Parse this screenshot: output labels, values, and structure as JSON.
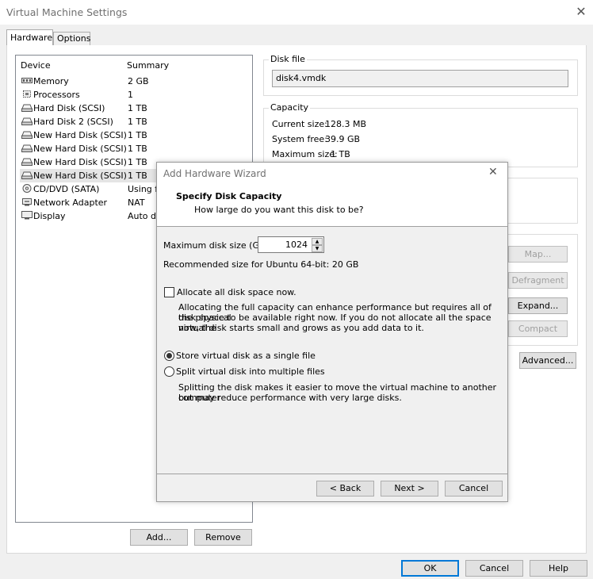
{
  "window": {
    "title": "Virtual Machine Settings"
  },
  "tabs": [
    {
      "label": "Hardware"
    },
    {
      "label": "Options"
    }
  ],
  "devices": {
    "header_device": "Device",
    "header_summary": "Summary",
    "items": [
      {
        "name": "Memory",
        "summary": "2 GB",
        "icon": "memory-icon"
      },
      {
        "name": "Processors",
        "summary": "1",
        "icon": "processor-icon"
      },
      {
        "name": "Hard Disk (SCSI)",
        "summary": "1 TB",
        "icon": "hard-disk-icon"
      },
      {
        "name": "Hard Disk 2 (SCSI)",
        "summary": "1 TB",
        "icon": "hard-disk-icon"
      },
      {
        "name": "New Hard Disk (SCSI)",
        "summary": "1 TB",
        "icon": "hard-disk-icon"
      },
      {
        "name": "New Hard Disk (SCSI)",
        "summary": "1 TB",
        "icon": "hard-disk-icon"
      },
      {
        "name": "New Hard Disk (SCSI)",
        "summary": "1 TB",
        "icon": "hard-disk-icon"
      },
      {
        "name": "New Hard Disk (SCSI)",
        "summary": "1 TB",
        "icon": "hard-disk-icon"
      },
      {
        "name": "CD/DVD (SATA)",
        "summary": "Using fil",
        "icon": "cd-dvd-icon"
      },
      {
        "name": "Network Adapter",
        "summary": "NAT",
        "icon": "network-adapter-icon"
      },
      {
        "name": "Display",
        "summary": "Auto de",
        "icon": "display-icon"
      }
    ],
    "selected_index": 7,
    "add_label": "Add...",
    "remove_label": "Remove"
  },
  "disk_file": {
    "label": "Disk file",
    "value": "disk4.vmdk"
  },
  "capacity": {
    "label": "Capacity",
    "current_size_label": "Current size:",
    "current_size_value": "128.3 MB",
    "system_free_label": "System free:",
    "system_free_value": "39.9 GB",
    "maximum_size_label": "Maximum size:",
    "maximum_size_value": "1 TB"
  },
  "utilities": {
    "map_label": "Map...",
    "defragment_label": "Defragment",
    "expand_label": "Expand...",
    "compact_label": "Compact",
    "advanced_label": "Advanced..."
  },
  "footer": {
    "ok_label": "OK",
    "cancel_label": "Cancel",
    "help_label": "Help"
  },
  "wizard": {
    "title": "Add Hardware Wizard",
    "heading": "Specify Disk Capacity",
    "subheading": "How large do you want this disk to be?",
    "max_size_label": "Maximum disk size (GB):",
    "max_size_value": "1024",
    "recommended": "Recommended size for Ubuntu 64-bit: 20 GB",
    "allocate_label": "Allocate all disk space now.",
    "allocate_checked": false,
    "allocate_desc_1": "Allocating the full capacity can enhance performance but requires all of the physical",
    "allocate_desc_2": "disk space to be available right now. If you do not allocate all the space now, the",
    "allocate_desc_3": "virtual disk starts small and grows as you add data to it.",
    "single_file_label": "Store virtual disk as a single file",
    "multi_file_label": "Split virtual disk into multiple files",
    "selected_option": "single",
    "split_desc_1": "Splitting the disk makes it easier to move the virtual machine to another computer",
    "split_desc_2": "but may reduce performance with very large disks.",
    "back_label": "< Back",
    "next_label": "Next >",
    "cancel_label": "Cancel"
  }
}
